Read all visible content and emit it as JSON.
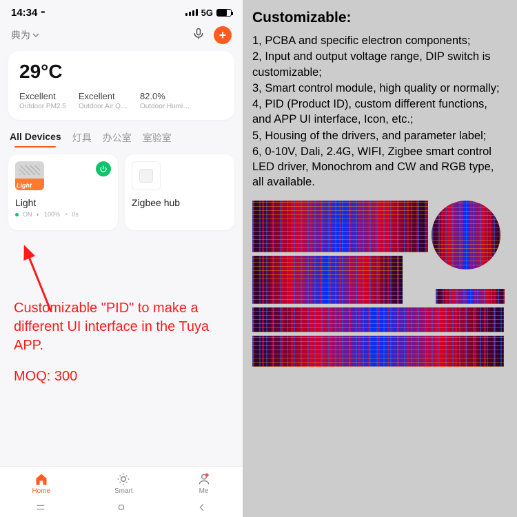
{
  "status": {
    "time": "14:34 ⁃",
    "net": "5G"
  },
  "header": {
    "home_label": "典为"
  },
  "weather": {
    "temp": "29°C",
    "items": [
      {
        "value": "Excellent",
        "label": "Outdoor PM2.5"
      },
      {
        "value": "Excellent",
        "label": "Outdoor Air Q…"
      },
      {
        "value": "82.0%",
        "label": "Outdoor Humi…"
      }
    ]
  },
  "tabs": [
    {
      "label": "All Devices",
      "active": true
    },
    {
      "label": "灯具"
    },
    {
      "label": "办公室"
    },
    {
      "label": "室验室"
    }
  ],
  "devices": {
    "light": {
      "name": "Light",
      "stats": {
        "on": "ON",
        "dim": "100%",
        "extra": "0s"
      }
    },
    "hub": {
      "name": "Zigbee hub"
    }
  },
  "annotation": {
    "text": "Customizable \"PID\" to make a different UI interface in the Tuya APP.",
    "moq": "MOQ: 300"
  },
  "bottomnav": {
    "home": "Home",
    "smart": "Smart",
    "me": "Me"
  },
  "right": {
    "heading": "Customizable:",
    "items": [
      "1, PCBA and specific electron components;",
      "2, Input and output voltage range, DIP switch is customizable;",
      "3, Smart control module, high quality or normally;",
      "4, PID (Product ID), custom different functions, and APP UI interface, Icon, etc.;",
      "5, Housing of the drivers, and parameter label;",
      "6, 0-10V, Dali, 2.4G, WIFI, Zigbee smart control LED driver, Monochrom and CW and RGB type, all available."
    ]
  }
}
